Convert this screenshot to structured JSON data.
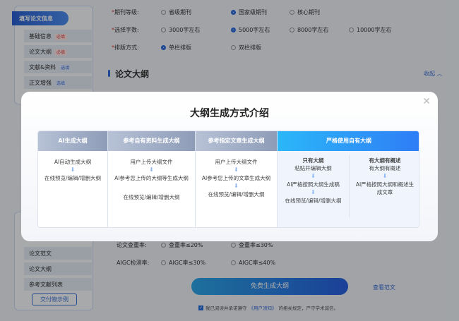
{
  "sidebar": {
    "section1": "填写论文信息",
    "items": [
      {
        "label": "基础信息",
        "tag": "必填"
      },
      {
        "label": "论文大纲",
        "tag": "必填"
      },
      {
        "label": "文献&资料",
        "tag": "选填"
      },
      {
        "label": "正文增强",
        "tag": "选填"
      }
    ],
    "items2": [
      "论文范文",
      "论文大纲",
      "参考文献列表"
    ],
    "demo_button": "交付物示例"
  },
  "form": {
    "journal": {
      "label": "期刊等级:",
      "options": [
        "省级期刊",
        "国家级期刊",
        "核心期刊"
      ],
      "selected": 1
    },
    "words": {
      "label": "选择字数:",
      "options": [
        "3000字左右",
        "5000字左右",
        "8000字左右",
        "10000字左右"
      ],
      "selected": 1
    },
    "layout": {
      "label": "排版方式:",
      "options": [
        "单栏排版",
        "双栏排版"
      ],
      "selected": 0
    },
    "outline_heading": "论文大纲",
    "collapse": "收起",
    "dup": {
      "label": "论文查重率:",
      "options": [
        "查重率≤20%",
        "查重率≤30%"
      ]
    },
    "aigc": {
      "label": "AIGC检测率:",
      "options": [
        "AIGC率≤30%",
        "AIGC率≤40%"
      ]
    },
    "generate": "免费生成大纲",
    "view_sample": "查看范文",
    "agree_pre": "我已阅读并承诺遵守",
    "agree_link": "《用户须知》",
    "agree_post": "的相关规定，严守学术诚信。"
  },
  "modal": {
    "title": "大纲生成方式介绍",
    "columns": [
      {
        "header": "AI生成大纲",
        "steps": [
          "AI自动生成大纲",
          "在线预览/编辑/增删大纲"
        ]
      },
      {
        "header": "参考自有资料生成大纲",
        "steps": [
          "用户上传大纲文件",
          "AI参考您上传的大纲等生成大纲",
          "在线预览/编辑/增删大纲"
        ]
      },
      {
        "header": "参考指定文章生成大纲",
        "steps": [
          "用户上传大纲文件",
          "AI参考您上传的文章生成大纲",
          "在线预览/编辑/增删大纲"
        ]
      },
      {
        "header": "严格使用自有大纲",
        "sub": [
          {
            "title": "只有大纲",
            "steps": [
              "粘贴并编辑大纲",
              "AI严格按照大纲生成稿",
              "在线预览/编辑/增删大纲"
            ]
          },
          {
            "title": "有大纲有概述",
            "steps": [
              "有大纲有概述",
              "AI严格按照大纲和概述生成文章"
            ]
          }
        ]
      }
    ]
  }
}
